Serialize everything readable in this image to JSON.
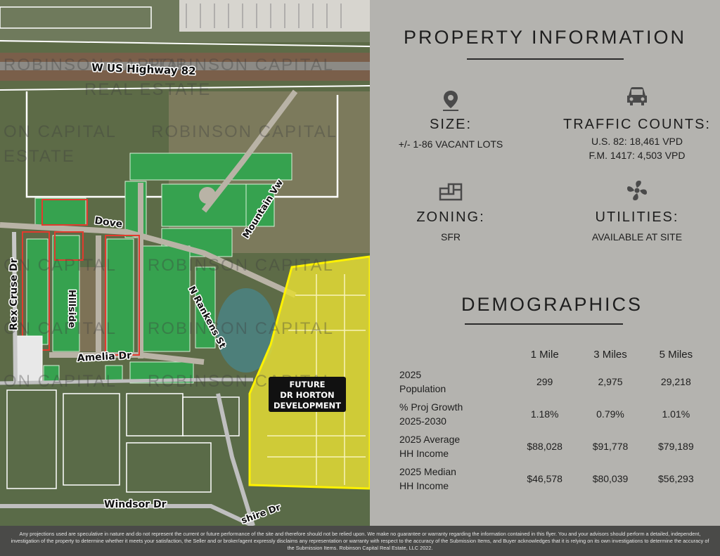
{
  "map": {
    "roads": {
      "highway": "W US Highway 82",
      "rex_cruse": "Rex Cruse Dr",
      "dove": "Dove",
      "amelia": "Amelia Dr",
      "rankens": "N Rankens St",
      "mountain_view": "Mountain Vw",
      "windsor": "Windsor Dr",
      "shire": "shire Dr",
      "hillside": "Hillside"
    },
    "watermark": [
      "ROBINSON CAPITAL",
      "ESTATE",
      "REAL ESTATE",
      "ON CAPITAL"
    ],
    "callout": [
      "FUTURE",
      "DR HORTON",
      "DEVELOPMENT"
    ],
    "colors": {
      "lots": "#35a04e",
      "future": "#e8e13a",
      "water": "#5a8a86"
    }
  },
  "property": {
    "title": "PROPERTY INFORMATION",
    "size": {
      "label": "SIZE:",
      "value": "+/- 1-86 VACANT LOTS",
      "icon": "map-pin-icon"
    },
    "traffic": {
      "label": "TRAFFIC COUNTS:",
      "lines": [
        "U.S. 82: 18,461 VPD",
        "F.M. 1417: 4,503 VPD"
      ],
      "icon": "car-icon"
    },
    "zoning": {
      "label": "ZONING:",
      "value": "SFR",
      "icon": "zoning-icon"
    },
    "utilities": {
      "label": "UTILITIES:",
      "value": "AVAILABLE AT SITE",
      "icon": "fan-icon"
    }
  },
  "demographics": {
    "title": "DEMOGRAPHICS",
    "columns": [
      "1 Mile",
      "3 Miles",
      "5 Miles"
    ],
    "rows": [
      {
        "label": [
          "2025",
          "Population"
        ],
        "values": [
          "299",
          "2,975",
          "29,218"
        ]
      },
      {
        "label": [
          "% Proj Growth",
          "2025-2030"
        ],
        "values": [
          "1.18%",
          "0.79%",
          "1.01%"
        ]
      },
      {
        "label": [
          "2025 Average",
          "HH Income"
        ],
        "values": [
          "$88,028",
          "$91,778",
          "$79,189"
        ]
      },
      {
        "label": [
          "2025 Median",
          "HH Income"
        ],
        "values": [
          "$46,578",
          "$80,039",
          "$56,293"
        ]
      }
    ]
  },
  "footer": {
    "disclaimer": "Any projections used are speculative in nature and do not represent the current or future performance of the site and therefore should not be relied upon. We make no guarantee or warranty regarding the information contained in this flyer. You and your advisors should perform a detailed, independent, investigation of the property to determine whether it meets your satisfaction, the Seller and or broker/agent expressly disclaims any representation or warranty with respect to the accuracy of the Submission Items, and Buyer acknowledges that it is relying on its own investigations to determine the accuracy of the Submission Items. Robinson Capital Real Estate, LLC 2022."
  }
}
